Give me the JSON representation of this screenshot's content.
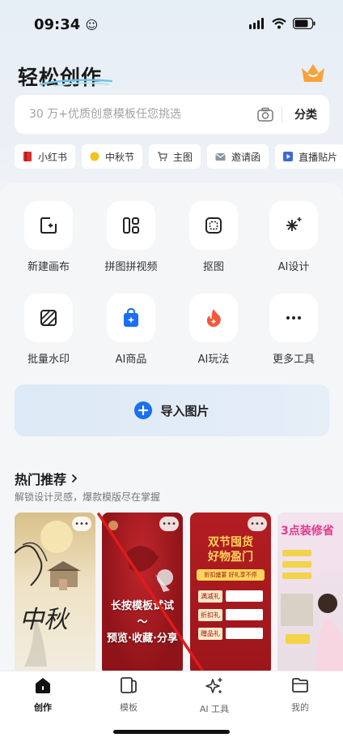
{
  "status_bar": {
    "time": "09:34"
  },
  "header": {
    "brand": "轻松创作"
  },
  "search": {
    "placeholder": "30 万+优质创意模板任您挑选",
    "classify_label": "分类"
  },
  "chips": [
    {
      "label": "小红书",
      "icon": "red-book-icon",
      "color": "#e02c2c"
    },
    {
      "label": "中秋节",
      "icon": "moon-icon",
      "color": "#f4c21c"
    },
    {
      "label": "主图",
      "icon": "cart-icon",
      "color": "#666666"
    },
    {
      "label": "邀请函",
      "icon": "envelope-icon",
      "color": "#666666"
    },
    {
      "label": "直播贴片",
      "icon": "play-icon",
      "color": "#3d6ad6"
    }
  ],
  "tools": [
    {
      "label": "新建画布",
      "icon": "new-canvas-icon"
    },
    {
      "label": "拼图拼视频",
      "icon": "collage-icon"
    },
    {
      "label": "抠图",
      "icon": "cutout-icon"
    },
    {
      "label": "AI设计",
      "icon": "sparkle-icon"
    },
    {
      "label": "批量水印",
      "icon": "watermark-icon"
    },
    {
      "label": "AI商品",
      "icon": "shopping-bag-icon"
    },
    {
      "label": "AI玩法",
      "icon": "flame-icon"
    },
    {
      "label": "更多工具",
      "icon": "more-icon"
    }
  ],
  "import": {
    "label": "导入图片"
  },
  "hot": {
    "title": "热门推荐",
    "subtitle": "解锁设计灵感，爆款模版尽在掌握"
  },
  "cards": [
    {
      "text": "中秋"
    },
    {
      "overlay_line1": "长按模板试试",
      "overlay_line2": "～",
      "overlay_line3": "预览·收藏·分享"
    },
    {
      "headline_1": "双节囤货",
      "headline_2": "好物盈门",
      "ribbon": "折扣盛宴 好礼享不停",
      "rows": [
        "满减礼",
        "折扣礼",
        "赠品礼"
      ]
    },
    {
      "headline": "3点装修省"
    }
  ],
  "tabbar": [
    {
      "label": "创作",
      "icon": "home-icon",
      "active": true
    },
    {
      "label": "模板",
      "icon": "template-icon",
      "active": false
    },
    {
      "label": "AI 工具",
      "icon": "ai-tools-icon",
      "active": false
    },
    {
      "label": "我的",
      "icon": "folder-icon",
      "active": false
    }
  ],
  "colors": {
    "accent": "#1c6ef2",
    "card_red": "#b31d22",
    "crown": "#f7a23a"
  }
}
